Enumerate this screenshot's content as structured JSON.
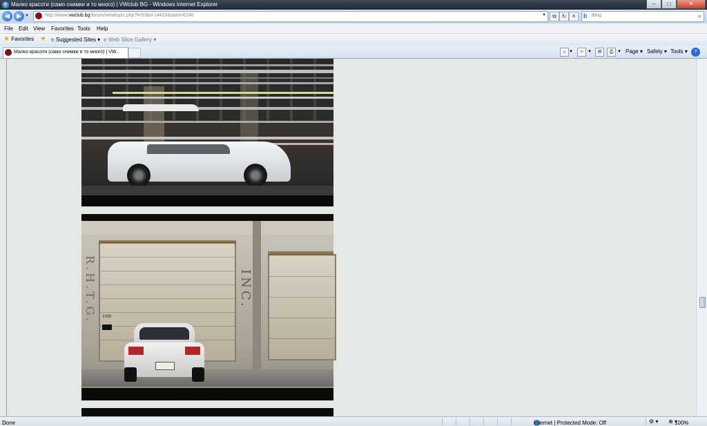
{
  "window": {
    "title": "Малко красоти (само снимки и то много) | VWclub BG - Windows Internet Explorer"
  },
  "address": {
    "url_prefix": "http://www.",
    "url_domain": "vwclub.bg",
    "url_path": "/forum/viewtopic.php?f=53&t=14429&start=6240"
  },
  "search": {
    "placeholder": "Bing"
  },
  "menu": {
    "file": "File",
    "edit": "Edit",
    "view": "View",
    "favorites": "Favorites",
    "tools": "Tools",
    "help": "Help"
  },
  "favorites_bar": {
    "favorites": "Favorites",
    "suggested": "Suggested Sites",
    "gallery": "Web Slice Gallery"
  },
  "tab": {
    "label": "Малко красоти (само снимки и то много) | VW..."
  },
  "command_bar": {
    "page": "Page",
    "safety": "Safety",
    "tools": "Tools"
  },
  "status": {
    "text": "Done",
    "zone": "Internet | Protected Mode: Off",
    "zoom": "100%"
  },
  "photo2": {
    "sign_left": "R.H.T.G.",
    "sign_right": "INC.",
    "number": "1005"
  },
  "colors": {
    "page_bg": "#e4e9e6",
    "titlebar": "#2b3542",
    "toolbar": "#dbe7f4"
  }
}
